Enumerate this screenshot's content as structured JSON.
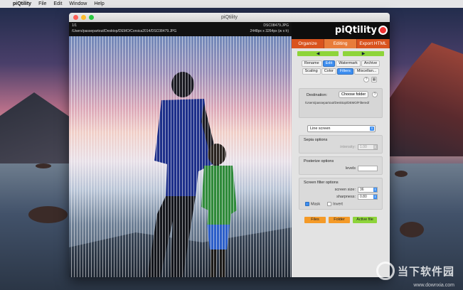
{
  "menubar": {
    "app": "piQtility",
    "items": [
      "File",
      "Edit",
      "Window",
      "Help"
    ]
  },
  "window": {
    "title": "piQtility"
  },
  "viewer": {
    "count": "1/1",
    "path": "/Users/passepartout/Desktop/DEMO/Corsica2014/DSC08479.JPG",
    "filename": "DSC08479.JPG",
    "dimensions": "2448px x 3264px (w x h)",
    "effect": "line screen stripes"
  },
  "panel": {
    "logo": "piQtility",
    "main_tabs": [
      "Organize",
      "Editing",
      "Export HTML"
    ],
    "active_main_tab": "Editing",
    "sub_row1": [
      "Rename",
      "Edit",
      "Watermark",
      "Archive"
    ],
    "sub_row1_active": "Edit",
    "sub_row2": [
      "Scaling",
      "Color",
      "Filters",
      "Miscellan..."
    ],
    "sub_row2_active": "Filters",
    "help_glyph": "?",
    "destination_label": "Destination:",
    "choose_folder": "Choose folder",
    "destination_path": "/Users/passepartout/Desktop/DEMO/Filtered/",
    "filter_select": "Line screen",
    "sepia": {
      "title": "Sepia options",
      "label": "intensity:",
      "value": "1.00"
    },
    "posterize": {
      "title": "Posterize options",
      "label": "levels",
      "value": ""
    },
    "screen": {
      "title": "Screen filter options",
      "size_label": "screen size:",
      "size_value": "36",
      "sharp_label": "sharpness:",
      "sharp_value": "0.80",
      "mask_label": "Mask",
      "mask_checked": true,
      "invert_label": "Invert",
      "invert_checked": false
    },
    "actions": [
      "Files",
      "Folder",
      "Active file"
    ]
  },
  "watermark": {
    "text": "当下软件园",
    "url": "www.downxia.com"
  },
  "colors": {
    "accent_orange": "#d9531e",
    "nav_green": "#8ed43a",
    "selection_blue": "#3d8ef0"
  }
}
